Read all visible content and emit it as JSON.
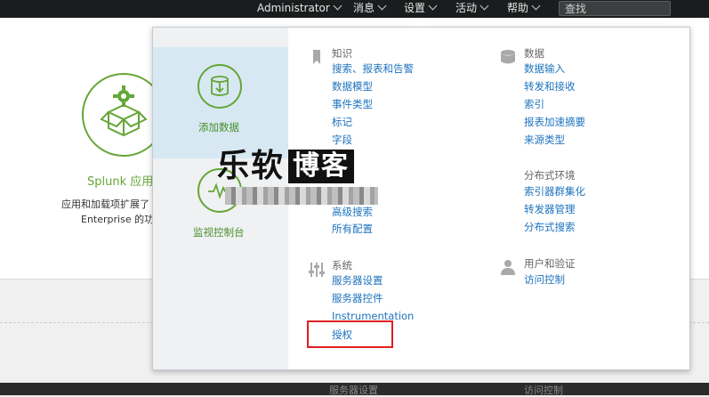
{
  "topnav": {
    "admin": "Administrator",
    "messages": "消息",
    "settings": "设置",
    "activity": "活动",
    "help": "帮助",
    "search_placeholder": "查找"
  },
  "background_app": {
    "title": "Splunk 应用",
    "desc_line1": "应用和加载项扩展了",
    "desc_line2": "Enterprise 的功"
  },
  "left_panel": {
    "add_data": "添加数据",
    "monitor_console": "监视控制台"
  },
  "knowledge": {
    "title": "知识",
    "items": [
      "搜索、报表和告警",
      "数据模型",
      "事件类型",
      "标记",
      "字段"
    ]
  },
  "knowledge_more": {
    "items": [
      "高级搜索",
      "所有配置"
    ]
  },
  "system": {
    "title": "系统",
    "items": [
      "服务器设置",
      "服务器控件",
      "Instrumentation",
      "授权"
    ]
  },
  "data": {
    "title": "数据",
    "items": [
      "数据输入",
      "转发和接收",
      "索引",
      "报表加速摘要",
      "来源类型"
    ]
  },
  "distributed": {
    "title": "分布式环境",
    "items": [
      "索引器群集化",
      "转发器管理",
      "分布式搜索"
    ]
  },
  "users": {
    "title": "用户和验证",
    "items": [
      "访问控制"
    ]
  },
  "watermark": {
    "part1": "乐软",
    "part2": "博客"
  },
  "ghost_bottom": {
    "left": "服务器设置",
    "right": "访问控制"
  },
  "colors": {
    "accent_green": "#65a637",
    "link_blue": "#1e73be",
    "topbar": "#1a1c1d",
    "highlight_red": "#e02020"
  }
}
